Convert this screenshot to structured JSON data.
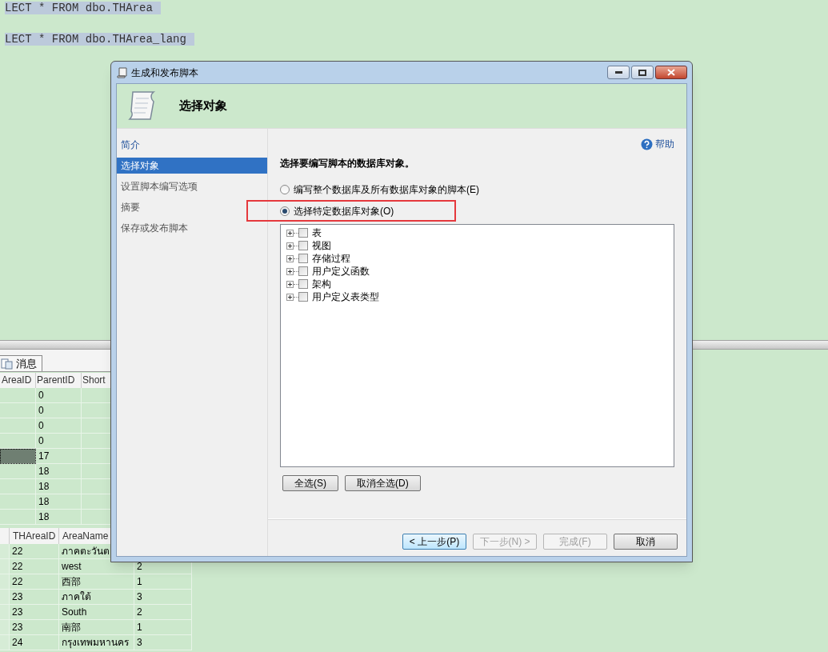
{
  "editor": {
    "lines": [
      "LECT * FROM dbo.THArea",
      "LECT * FROM dbo.THArea_lang"
    ]
  },
  "results": {
    "tabs": [
      {
        "label": "消息"
      }
    ],
    "grid_1": {
      "columns": [
        "AreaID",
        "ParentID",
        "Short"
      ],
      "rows": [
        {
          "parent_id": "0",
          "selected": false
        },
        {
          "parent_id": "0",
          "selected": false
        },
        {
          "parent_id": "0",
          "selected": false
        },
        {
          "parent_id": "0",
          "selected": false
        },
        {
          "parent_id": "17",
          "selected": true
        },
        {
          "parent_id": "18",
          "selected": false
        },
        {
          "parent_id": "18",
          "selected": false
        },
        {
          "parent_id": "18",
          "selected": false
        },
        {
          "parent_id": "18",
          "selected": false
        }
      ]
    },
    "grid_2": {
      "columns": [
        "THAreaID",
        "AreaName"
      ],
      "rows": [
        {
          "tharea_id": "22",
          "area_name": "ภาคตะวันต"
        },
        {
          "tharea_id": "22",
          "area_name": "west",
          "column_4": "2"
        },
        {
          "tharea_id": "22",
          "area_name": "西部",
          "column_4": "1"
        },
        {
          "tharea_id": "23",
          "area_name": "ภาคใต้",
          "column_4": "3"
        },
        {
          "tharea_id": "23",
          "area_name": "South",
          "column_4": "2"
        },
        {
          "tharea_id": "23",
          "area_name": "南部",
          "column_4": "1"
        },
        {
          "tharea_id": "24",
          "area_name": "กรุงเทพมหานคร",
          "column_4": "3"
        }
      ]
    }
  },
  "dialog": {
    "title": "生成和发布脚本",
    "header": "选择对象",
    "nav": [
      {
        "label": "简介",
        "selected": false,
        "kind": "link"
      },
      {
        "label": "选择对象",
        "selected": true,
        "kind": "step"
      },
      {
        "label": "设置脚本编写选项",
        "selected": false,
        "kind": "step"
      },
      {
        "label": "摘要",
        "selected": false,
        "kind": "step"
      },
      {
        "label": "保存或发布脚本",
        "selected": false,
        "kind": "step"
      }
    ],
    "help": "帮助",
    "prompt": "选择要编写脚本的数据库对象。",
    "options": [
      {
        "label": "编写整个数据库及所有数据库对象的脚本(E)",
        "selected": false,
        "highlighted": false
      },
      {
        "label": "选择特定数据库对象(O)",
        "selected": true,
        "highlighted": true
      }
    ],
    "tree": [
      {
        "label": "表",
        "checked": false,
        "expanded": false
      },
      {
        "label": "视图",
        "checked": false,
        "expanded": false
      },
      {
        "label": "存储过程",
        "checked": false,
        "expanded": false
      },
      {
        "label": "用户定义函数",
        "checked": false,
        "expanded": false
      },
      {
        "label": "架构",
        "checked": false,
        "expanded": false
      },
      {
        "label": "用户定义表类型",
        "checked": false,
        "expanded": false
      }
    ],
    "list_buttons": [
      "全选(S)",
      "取消全选(D)"
    ],
    "footer_buttons": [
      {
        "label": "< 上一步(P)",
        "disabled": false,
        "focused": true
      },
      {
        "label": "下一步(N) >",
        "disabled": true,
        "focused": false
      },
      {
        "label": "完成(F)",
        "disabled": true,
        "focused": false
      },
      {
        "label": "取消",
        "disabled": false,
        "focused": false
      }
    ]
  }
}
